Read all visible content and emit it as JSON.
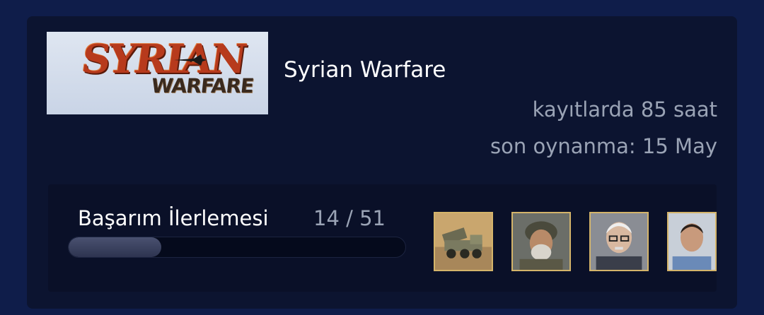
{
  "game": {
    "title": "Syrian Warfare",
    "capsule_logo_top": "SYRIAN",
    "capsule_logo_bottom": "WARFARE",
    "playtime": "kayıtlarda 85 saat",
    "last_played": "son oynanma: 15 May"
  },
  "achievements": {
    "label": "Başarım İlerlemesi",
    "count": "14 / 51",
    "unlocked": 14,
    "total": 51,
    "icons": [
      {
        "name": "rocket-launcher-truck-icon"
      },
      {
        "name": "soldier-portrait-icon"
      },
      {
        "name": "elderly-man-portrait-icon"
      },
      {
        "name": "man-portrait-icon"
      }
    ]
  },
  "colors": {
    "background": "#0f1d4a",
    "card": "#0c1430",
    "panel": "#0a1028",
    "muted_text": "#9aa3b5",
    "icon_border": "#d4b46a"
  }
}
